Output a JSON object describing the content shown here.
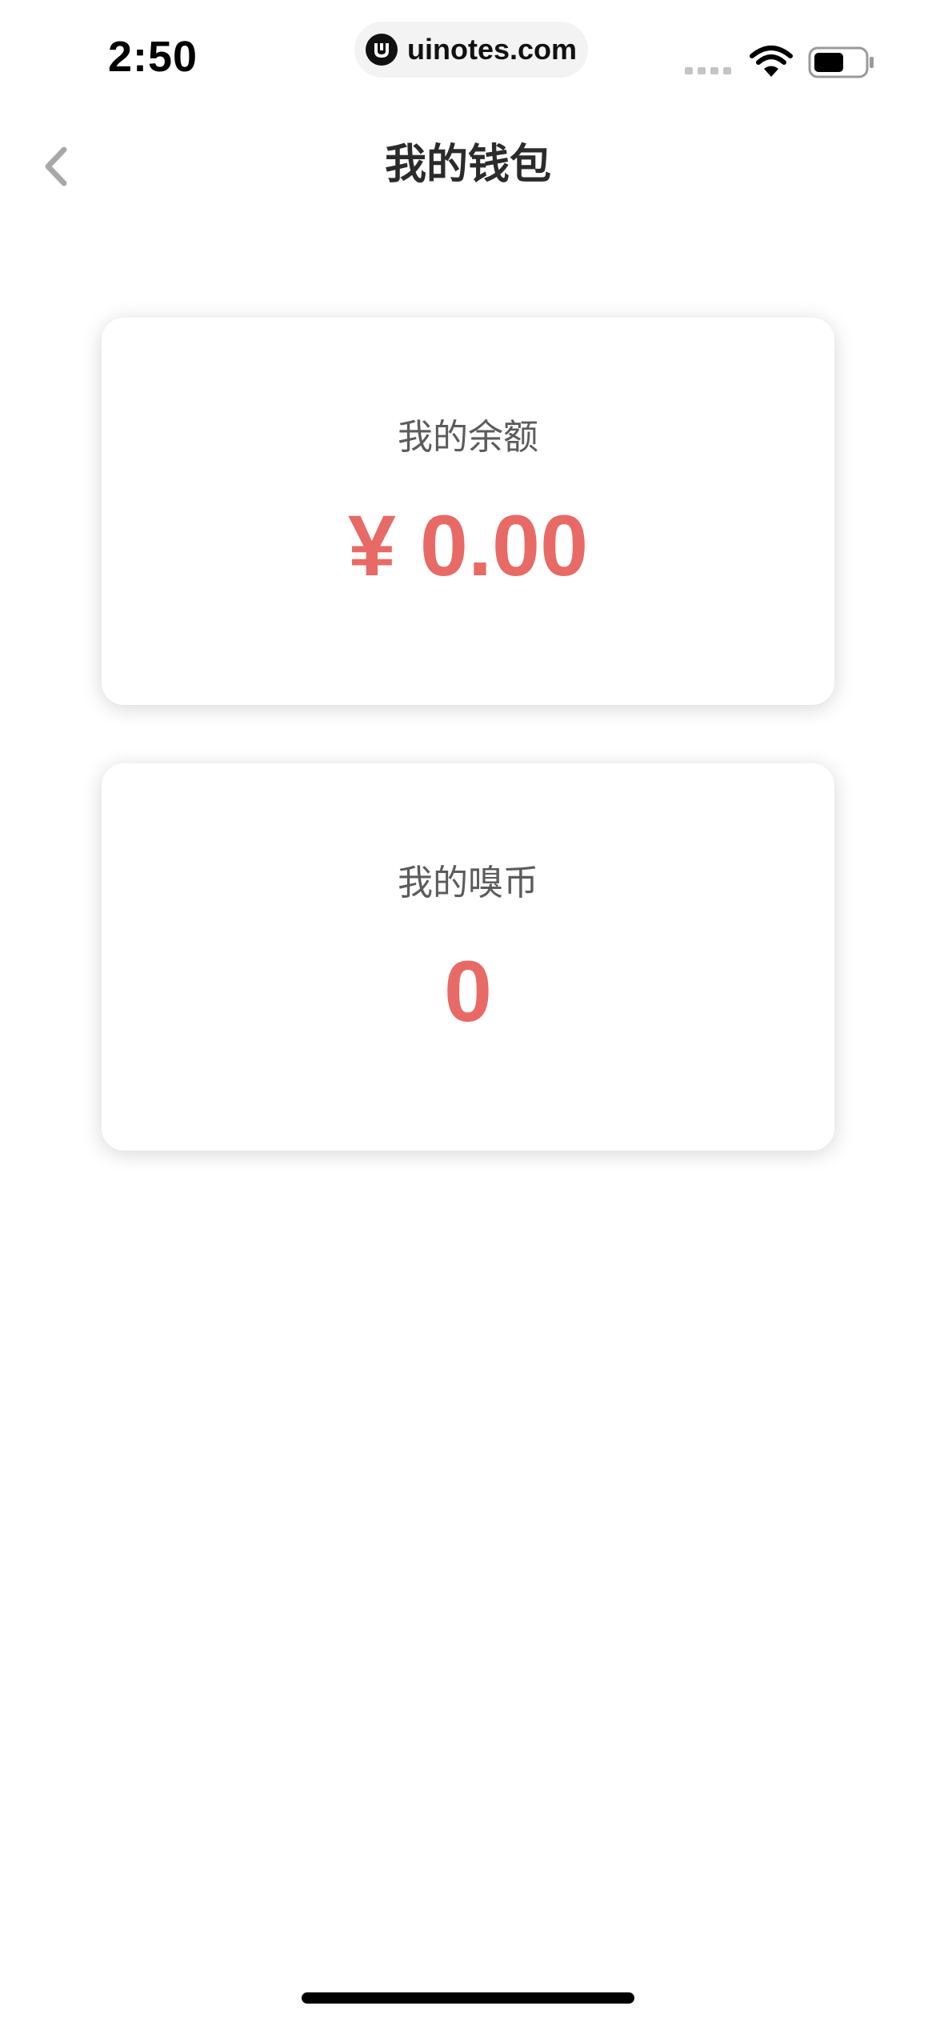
{
  "status_bar": {
    "time": "2:50",
    "url": "uinotes.com"
  },
  "nav": {
    "title": "我的钱包"
  },
  "wallet": {
    "balance_label": "我的余额",
    "balance_value": "¥ 0.00",
    "coins_label": "我的嗅币",
    "coins_value": "0"
  },
  "colors": {
    "accent": "#e86a66",
    "title": "#2b2b2b",
    "label": "#5c5c5c"
  },
  "icons": {
    "back": "chevron-left-icon",
    "site": "uinotes-logo-icon",
    "wifi": "wifi-icon",
    "battery": "battery-icon",
    "signal": "cellular-signal-icon"
  }
}
